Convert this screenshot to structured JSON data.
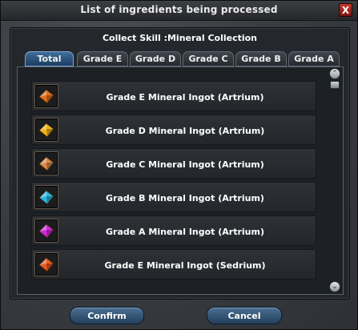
{
  "window": {
    "title": "List of ingredients being processed",
    "close_glyph": "X"
  },
  "panel": {
    "subtitle": "Collect Skill :Mineral Collection"
  },
  "tabs": [
    {
      "label": "Total",
      "active": true
    },
    {
      "label": "Grade E",
      "active": false
    },
    {
      "label": "Grade D",
      "active": false
    },
    {
      "label": "Grade C",
      "active": false
    },
    {
      "label": "Grade B",
      "active": false
    },
    {
      "label": "Grade A",
      "active": false
    }
  ],
  "items": [
    {
      "label": "Grade E Mineral Ingot (Artrium)",
      "icon": "orange-ingot-icon",
      "color": "#e0701c"
    },
    {
      "label": "Grade D Mineral Ingot (Artrium)",
      "icon": "yellow-ingot-icon",
      "color": "#f0b418"
    },
    {
      "label": "Grade C Mineral Ingot (Artrium)",
      "icon": "bronze-ingot-icon",
      "color": "#d98a4c"
    },
    {
      "label": "Grade B Mineral Ingot (Artrium)",
      "icon": "cyan-ingot-icon",
      "color": "#28b8e0"
    },
    {
      "label": "Grade A Mineral Ingot (Artrium)",
      "icon": "magenta-ingot-icon",
      "color": "#d02ad8"
    },
    {
      "label": "Grade E Mineral Ingot (Sedrium)",
      "icon": "orange-red-ingot-icon",
      "color": "#e85a22"
    }
  ],
  "scrollbar": {
    "up_glyph": "⌃",
    "down_glyph": "⌄"
  },
  "buttons": {
    "confirm_label": "Confirm",
    "cancel_label": "Cancel"
  }
}
